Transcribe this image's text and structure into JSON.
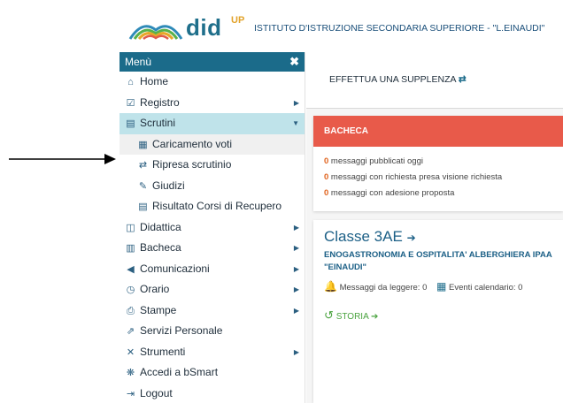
{
  "header": {
    "logo_text": "did",
    "logo_sup": "UP",
    "school_name": "ISTITUTO D'ISTRUZIONE SECONDARIA SUPERIORE - \"L.EINAUDI\""
  },
  "sidebar": {
    "title": "Menù",
    "close_glyph": "✖",
    "items": [
      {
        "label": "Home",
        "icon": "home-icon",
        "glyph": "⌂"
      },
      {
        "label": "Registro",
        "icon": "calendar-check-icon",
        "glyph": "☑",
        "arrow": "▶"
      },
      {
        "label": "Scrutini",
        "icon": "document-icon",
        "glyph": "▤",
        "arrow": "▼"
      },
      {
        "label": "Caricamento voti",
        "icon": "grid-icon",
        "glyph": "▦"
      },
      {
        "label": "Ripresa scrutinio",
        "icon": "retweet-icon",
        "glyph": "⇄"
      },
      {
        "label": "Giudizi",
        "icon": "edit-icon",
        "glyph": "✎"
      },
      {
        "label": "Risultato Corsi di Recupero",
        "icon": "document-icon",
        "glyph": "▤"
      },
      {
        "label": "Didattica",
        "icon": "book-icon",
        "glyph": "◫",
        "arrow": "▶"
      },
      {
        "label": "Bacheca",
        "icon": "newspaper-icon",
        "glyph": "▥",
        "arrow": "▶"
      },
      {
        "label": "Comunicazioni",
        "icon": "megaphone-icon",
        "glyph": "◀",
        "arrow": "▶"
      },
      {
        "label": "Orario",
        "icon": "clock-icon",
        "glyph": "◷",
        "arrow": "▶"
      },
      {
        "label": "Stampe",
        "icon": "printer-icon",
        "glyph": "⎙",
        "arrow": "▶"
      },
      {
        "label": "Servizi Personale",
        "icon": "external-link-icon",
        "glyph": "⇗"
      },
      {
        "label": "Strumenti",
        "icon": "tools-icon",
        "glyph": "✕",
        "arrow": "▶"
      },
      {
        "label": "Accedi a bSmart",
        "icon": "bsmart-icon",
        "glyph": "❋"
      },
      {
        "label": "Logout",
        "icon": "logout-icon",
        "glyph": "⇥"
      }
    ]
  },
  "main": {
    "supplenza_label": "EFFETTUA UNA SUPPLENZA",
    "supplenza_glyph": "⇄",
    "bacheca": {
      "title": "BACHECA",
      "lines": [
        {
          "count": "0",
          "text": " messaggi pubblicati oggi"
        },
        {
          "count": "0",
          "text": " messaggi con richiesta presa visione richiesta"
        },
        {
          "count": "0",
          "text": " messaggi con adesione proposta"
        }
      ]
    },
    "classe": {
      "title": "Classe 3AE",
      "enter_glyph": "➔",
      "description": "ENOGASTRONOMIA E OSPITALITA' ALBERGHIERA IPAA \"EINAUDI\"",
      "messages_label": "Messaggi da leggere: 0",
      "events_label": "Eventi calendario: 0",
      "storia_label": "STORIA",
      "bell_glyph": "🔔",
      "calendar_glyph": "▦",
      "history_glyph": "↺"
    }
  },
  "colors": {
    "menu_header": "#1b6b8a",
    "selected_item": "#bfe3ea",
    "bacheca_header": "#e85a4a",
    "accent_count": "#e0641f",
    "storia_green": "#4aa33f"
  }
}
